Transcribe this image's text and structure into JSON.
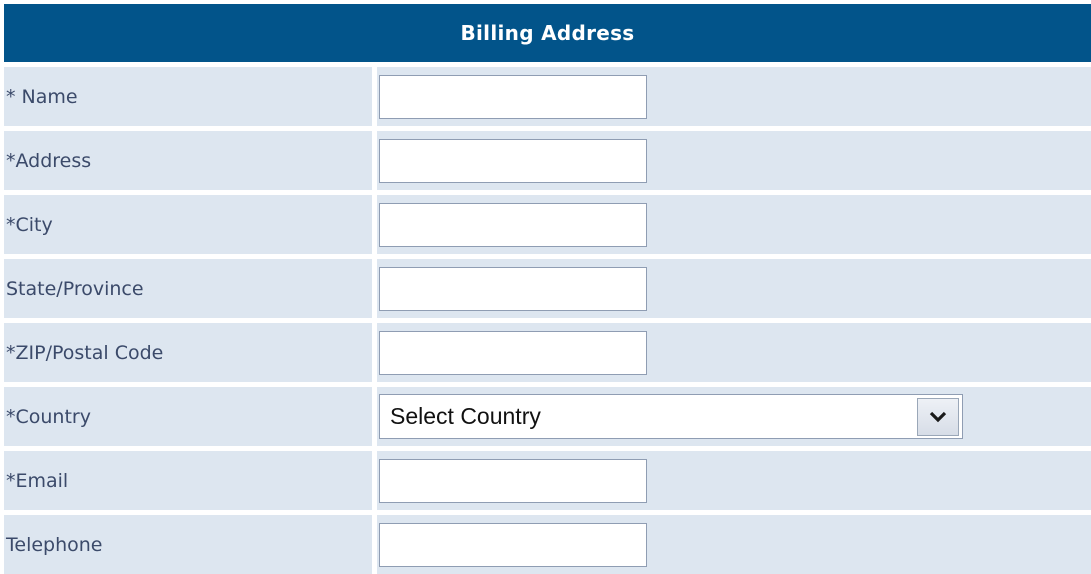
{
  "form": {
    "title": "Billing Address",
    "fields": [
      {
        "label": "* Name",
        "value": ""
      },
      {
        "label": "*Address",
        "value": ""
      },
      {
        "label": "*City",
        "value": ""
      },
      {
        "label": "State/Province",
        "value": ""
      },
      {
        "label": "*ZIP/Postal Code",
        "value": ""
      },
      {
        "label": "*Country",
        "selected": "Select Country"
      },
      {
        "label": "*Email",
        "value": ""
      },
      {
        "label": "Telephone",
        "value": ""
      }
    ]
  },
  "colors": {
    "header_bg": "#02548a",
    "row_bg": "#dde6f0",
    "label_text": "#3b4a6a"
  },
  "icons": {
    "country_dropdown": "chevron-down-icon"
  }
}
